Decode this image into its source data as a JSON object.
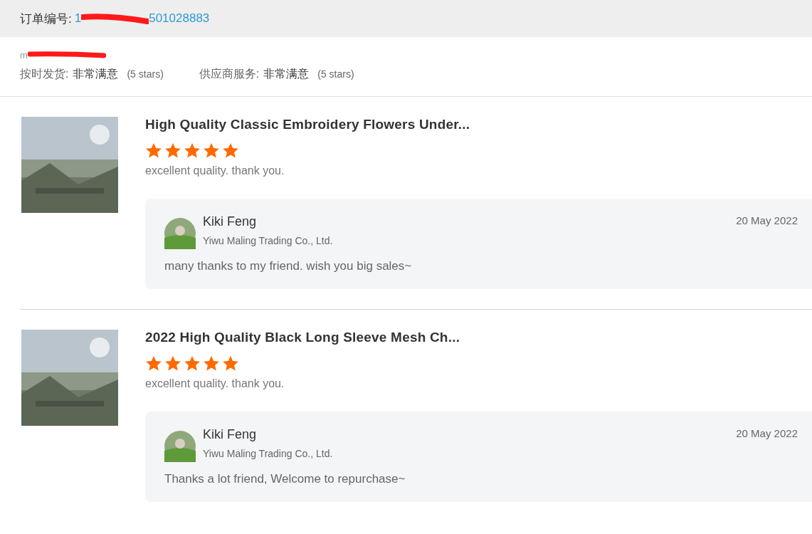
{
  "order": {
    "label": "订单编号:",
    "number_start": "1",
    "number_end": "501028883"
  },
  "buyer": {
    "name_start": "m"
  },
  "ratings": [
    {
      "label": "按时发货:",
      "value": "非常满意",
      "note": "(5 stars)"
    },
    {
      "label": "供应商服务:",
      "value": "非常满意",
      "note": "(5 stars)"
    }
  ],
  "reviews": [
    {
      "kind": "picture",
      "title": "High Quality Classic Embroidery Flowers Under...",
      "stars": 5,
      "comment": "excellent quality. thank you.",
      "reply": {
        "name": "Kiki Feng",
        "company": "Yiwu Maling Trading Co., Ltd.",
        "date": "20 May 2022",
        "text": "many thanks to my friend. wish you big sales~"
      }
    },
    {
      "kind": "picture",
      "title": "2022 High Quality Black Long Sleeve Mesh Ch...",
      "stars": 5,
      "comment": "excellent quality. thank you.",
      "reply": {
        "name": "Kiki Feng",
        "company": "Yiwu Maling Trading Co., Ltd.",
        "date": "20 May 2022",
        "text": "Thanks a lot friend, Welcome to repurchase~"
      }
    }
  ]
}
